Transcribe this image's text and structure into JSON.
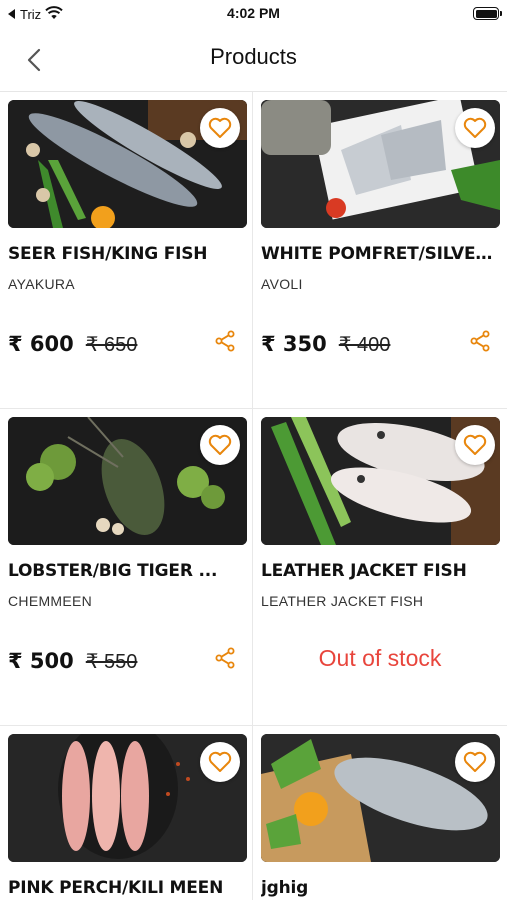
{
  "status_bar": {
    "carrier": "Triz",
    "time": "4:02 PM"
  },
  "header": {
    "title": "Products"
  },
  "colors": {
    "accent": "#e8860c",
    "out_of_stock": "#e8453c"
  },
  "products": [
    {
      "name": "SEER FISH/KING FISH",
      "subtitle": "AYAKURA",
      "price": "₹ 600",
      "mrp": "₹ 650",
      "in_stock": true
    },
    {
      "name": "WHITE POMFRET/SILVER...",
      "subtitle": "AVOLI",
      "price": "₹ 350",
      "mrp": "₹ 400",
      "in_stock": true
    },
    {
      "name": "LOBSTER/BIG TIGER ...",
      "subtitle": "CHEMMEEN",
      "price": "₹ 500",
      "mrp": "₹ 550",
      "in_stock": true
    },
    {
      "name": "LEATHER JACKET FISH",
      "subtitle": "LEATHER JACKET FISH",
      "status": "Out of stock",
      "in_stock": false
    },
    {
      "name": "PINK PERCH/KILI MEEN",
      "in_stock": true
    },
    {
      "name": "jghig",
      "in_stock": true
    }
  ]
}
